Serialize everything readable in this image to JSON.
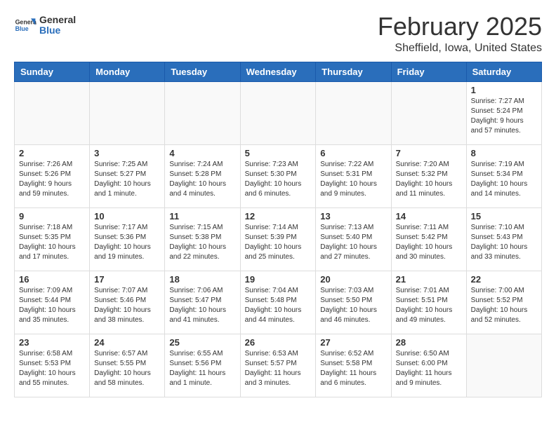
{
  "header": {
    "logo_general": "General",
    "logo_blue": "Blue",
    "month_title": "February 2025",
    "subtitle": "Sheffield, Iowa, United States"
  },
  "weekdays": [
    "Sunday",
    "Monday",
    "Tuesday",
    "Wednesday",
    "Thursday",
    "Friday",
    "Saturday"
  ],
  "weeks": [
    [
      {
        "day": "",
        "info": ""
      },
      {
        "day": "",
        "info": ""
      },
      {
        "day": "",
        "info": ""
      },
      {
        "day": "",
        "info": ""
      },
      {
        "day": "",
        "info": ""
      },
      {
        "day": "",
        "info": ""
      },
      {
        "day": "1",
        "info": "Sunrise: 7:27 AM\nSunset: 5:24 PM\nDaylight: 9 hours and 57 minutes."
      }
    ],
    [
      {
        "day": "2",
        "info": "Sunrise: 7:26 AM\nSunset: 5:26 PM\nDaylight: 9 hours and 59 minutes."
      },
      {
        "day": "3",
        "info": "Sunrise: 7:25 AM\nSunset: 5:27 PM\nDaylight: 10 hours and 1 minute."
      },
      {
        "day": "4",
        "info": "Sunrise: 7:24 AM\nSunset: 5:28 PM\nDaylight: 10 hours and 4 minutes."
      },
      {
        "day": "5",
        "info": "Sunrise: 7:23 AM\nSunset: 5:30 PM\nDaylight: 10 hours and 6 minutes."
      },
      {
        "day": "6",
        "info": "Sunrise: 7:22 AM\nSunset: 5:31 PM\nDaylight: 10 hours and 9 minutes."
      },
      {
        "day": "7",
        "info": "Sunrise: 7:20 AM\nSunset: 5:32 PM\nDaylight: 10 hours and 11 minutes."
      },
      {
        "day": "8",
        "info": "Sunrise: 7:19 AM\nSunset: 5:34 PM\nDaylight: 10 hours and 14 minutes."
      }
    ],
    [
      {
        "day": "9",
        "info": "Sunrise: 7:18 AM\nSunset: 5:35 PM\nDaylight: 10 hours and 17 minutes."
      },
      {
        "day": "10",
        "info": "Sunrise: 7:17 AM\nSunset: 5:36 PM\nDaylight: 10 hours and 19 minutes."
      },
      {
        "day": "11",
        "info": "Sunrise: 7:15 AM\nSunset: 5:38 PM\nDaylight: 10 hours and 22 minutes."
      },
      {
        "day": "12",
        "info": "Sunrise: 7:14 AM\nSunset: 5:39 PM\nDaylight: 10 hours and 25 minutes."
      },
      {
        "day": "13",
        "info": "Sunrise: 7:13 AM\nSunset: 5:40 PM\nDaylight: 10 hours and 27 minutes."
      },
      {
        "day": "14",
        "info": "Sunrise: 7:11 AM\nSunset: 5:42 PM\nDaylight: 10 hours and 30 minutes."
      },
      {
        "day": "15",
        "info": "Sunrise: 7:10 AM\nSunset: 5:43 PM\nDaylight: 10 hours and 33 minutes."
      }
    ],
    [
      {
        "day": "16",
        "info": "Sunrise: 7:09 AM\nSunset: 5:44 PM\nDaylight: 10 hours and 35 minutes."
      },
      {
        "day": "17",
        "info": "Sunrise: 7:07 AM\nSunset: 5:46 PM\nDaylight: 10 hours and 38 minutes."
      },
      {
        "day": "18",
        "info": "Sunrise: 7:06 AM\nSunset: 5:47 PM\nDaylight: 10 hours and 41 minutes."
      },
      {
        "day": "19",
        "info": "Sunrise: 7:04 AM\nSunset: 5:48 PM\nDaylight: 10 hours and 44 minutes."
      },
      {
        "day": "20",
        "info": "Sunrise: 7:03 AM\nSunset: 5:50 PM\nDaylight: 10 hours and 46 minutes."
      },
      {
        "day": "21",
        "info": "Sunrise: 7:01 AM\nSunset: 5:51 PM\nDaylight: 10 hours and 49 minutes."
      },
      {
        "day": "22",
        "info": "Sunrise: 7:00 AM\nSunset: 5:52 PM\nDaylight: 10 hours and 52 minutes."
      }
    ],
    [
      {
        "day": "23",
        "info": "Sunrise: 6:58 AM\nSunset: 5:53 PM\nDaylight: 10 hours and 55 minutes."
      },
      {
        "day": "24",
        "info": "Sunrise: 6:57 AM\nSunset: 5:55 PM\nDaylight: 10 hours and 58 minutes."
      },
      {
        "day": "25",
        "info": "Sunrise: 6:55 AM\nSunset: 5:56 PM\nDaylight: 11 hours and 1 minute."
      },
      {
        "day": "26",
        "info": "Sunrise: 6:53 AM\nSunset: 5:57 PM\nDaylight: 11 hours and 3 minutes."
      },
      {
        "day": "27",
        "info": "Sunrise: 6:52 AM\nSunset: 5:58 PM\nDaylight: 11 hours and 6 minutes."
      },
      {
        "day": "28",
        "info": "Sunrise: 6:50 AM\nSunset: 6:00 PM\nDaylight: 11 hours and 9 minutes."
      },
      {
        "day": "",
        "info": ""
      }
    ]
  ]
}
